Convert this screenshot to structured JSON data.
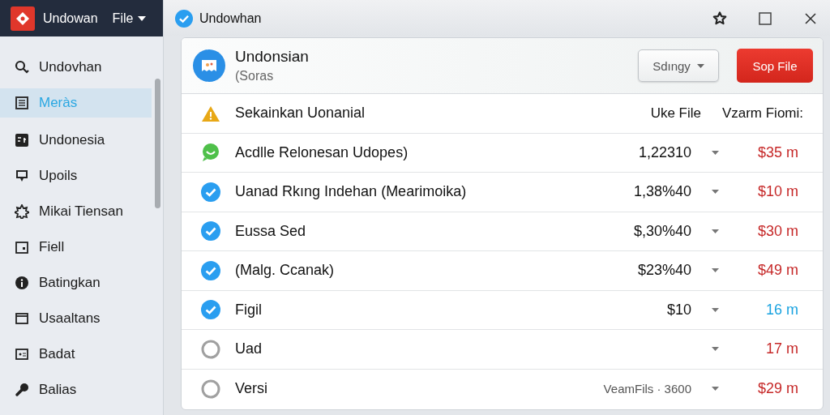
{
  "sidebar": {
    "app_name": "Undowan",
    "menu": "File",
    "items": [
      {
        "label": "Undovhan",
        "kind": "search",
        "selected": false
      },
      {
        "label": "Meràs",
        "kind": "list",
        "selected": true
      },
      {
        "label": "Undonesia",
        "kind": "tile",
        "selected": false
      },
      {
        "label": "Upoils",
        "kind": "chat",
        "selected": false
      },
      {
        "label": "Mikai Tiensan",
        "kind": "gear",
        "selected": false
      },
      {
        "label": "Fiell",
        "kind": "frame",
        "selected": false
      },
      {
        "label": "Batingkan",
        "kind": "info",
        "selected": false
      },
      {
        "label": "Usaaltans",
        "kind": "window",
        "selected": false
      },
      {
        "label": "Badat",
        "kind": "card",
        "selected": false
      },
      {
        "label": "Balias",
        "kind": "pin",
        "selected": false
      }
    ]
  },
  "window": {
    "title": "Undowhan"
  },
  "panel": {
    "title": "Undonsian",
    "subtitle": "(Soras",
    "dropdown": "Sdıngy",
    "action": "Sop File"
  },
  "table": {
    "columns": [
      "Sekainkan Uonanial",
      "Uke File",
      "Vzarm Fiomi:"
    ],
    "rows": [
      {
        "kind": "chat",
        "name": "Acdlle Relonesan Udopes)",
        "value": "1,22310",
        "amount": "$35 m",
        "color": "#c62828"
      },
      {
        "kind": "done",
        "name": "Uanad Rkıng Indehan (Mearimoika)",
        "value": "1,38%40",
        "amount": "$10 m",
        "color": "#c62828"
      },
      {
        "kind": "done",
        "name": "Eussa Sed",
        "value": "$,30%40",
        "amount": "$30 m",
        "color": "#c62828"
      },
      {
        "kind": "done",
        "name": "(Malg. Ccanak)",
        "value": "$23%40",
        "amount": "$49 m",
        "color": "#c62828"
      },
      {
        "kind": "done",
        "name": "Figil",
        "value": "$10",
        "amount": "16 m",
        "color": "#1aa3e0"
      },
      {
        "kind": "pending",
        "name": "Uad",
        "amount": "17 m",
        "color": "#c62828"
      },
      {
        "kind": "pending",
        "name": "Versi",
        "value": "VeamFils · 3600",
        "amount": "$29 m",
        "color": "#c62828"
      }
    ]
  }
}
